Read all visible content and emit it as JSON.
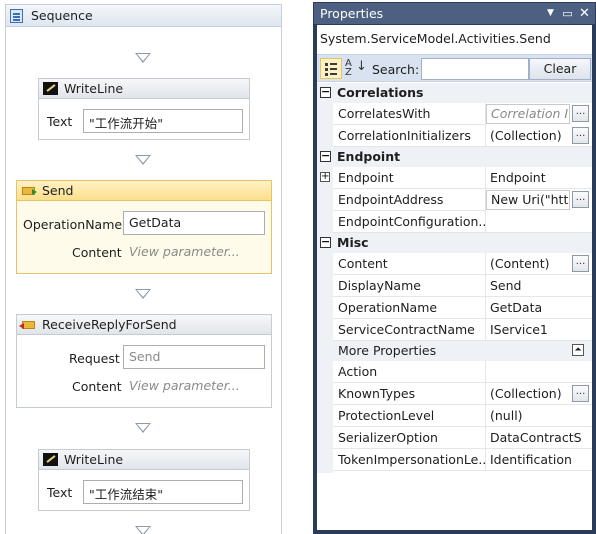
{
  "designer": {
    "sequence_title": "Sequence",
    "activities": [
      {
        "title": "WriteLine",
        "text_label": "Text",
        "text_value": "\"工作流开始\""
      },
      {
        "title": "Send",
        "operation_label": "OperationName",
        "operation_value": "GetData",
        "content_label": "Content",
        "content_placeholder": "View parameter..."
      },
      {
        "title": "ReceiveReplyForSend",
        "request_label": "Request",
        "request_value": "Send",
        "content_label": "Content",
        "content_placeholder": "View parameter..."
      },
      {
        "title": "WriteLine",
        "text_label": "Text",
        "text_value": "\"工作流结束\""
      }
    ]
  },
  "properties": {
    "window_title": "Properties",
    "title_icons": [
      "dropdown-icon",
      "maximize-icon",
      "close-icon"
    ],
    "type_name": "System.ServiceModel.Activities.Send",
    "toolbar": {
      "search_label": "Search:",
      "search_value": "",
      "clear_label": "Clear"
    },
    "categories": [
      {
        "name": "Correlations",
        "rows": [
          {
            "name": "CorrelatesWith",
            "value": "Correlation I"
          },
          {
            "name": "CorrelationInitializers",
            "value": "(Collection)"
          }
        ]
      },
      {
        "name": "Endpoint",
        "rows": [
          {
            "name": "Endpoint",
            "value": "Endpoint"
          },
          {
            "name": "EndpointAddress",
            "value": "New Uri(\"htt"
          },
          {
            "name": "EndpointConfiguration...",
            "value": ""
          }
        ]
      },
      {
        "name": "Misc",
        "rows": [
          {
            "name": "Content",
            "value": "(Content)"
          },
          {
            "name": "DisplayName",
            "value": "Send"
          },
          {
            "name": "OperationName",
            "value": "GetData"
          },
          {
            "name": "ServiceContractName",
            "value": "IService1"
          }
        ],
        "more_label": "More Properties",
        "more_rows": [
          {
            "name": "Action",
            "value": ""
          },
          {
            "name": "KnownTypes",
            "value": "(Collection)"
          },
          {
            "name": "ProtectionLevel",
            "value": "(null)"
          },
          {
            "name": "SerializerOption",
            "value": "DataContractS"
          },
          {
            "name": "TokenImpersonationLe...",
            "value": "Identification"
          }
        ]
      }
    ]
  },
  "colors": {
    "selected_border": "#e5c365",
    "selected_fill": "#fffbea",
    "panel_frame": "#2b3c59",
    "title_bar": "#4d6082"
  }
}
